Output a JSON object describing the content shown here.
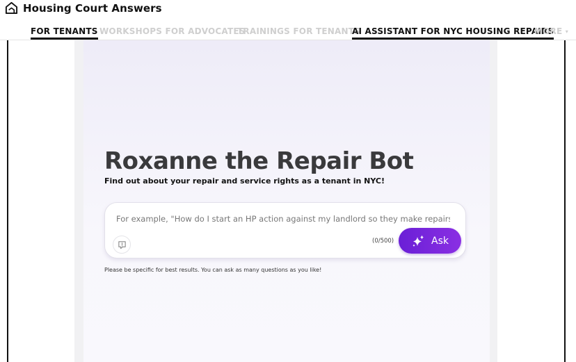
{
  "header": {
    "site_name": "Housing Court Answers",
    "logo_icon": "house-icon"
  },
  "nav": {
    "items": [
      {
        "label": "FOR TENANTS",
        "state": "active"
      },
      {
        "label": "WORKSHOPS FOR ADVOCATES",
        "state": "inactive"
      },
      {
        "label": "TRAININGS FOR TENANTS",
        "state": "inactive"
      },
      {
        "label": "AI ASSISTANT FOR NYC HOUSING REPAIRS",
        "state": "active"
      },
      {
        "label": "MORE",
        "state": "inactive",
        "icon": "chevron-down-icon"
      }
    ]
  },
  "main": {
    "title": "Roxanne the Repair Bot",
    "subtitle": "Find out about your repair and service rights as a tenant in NYC!",
    "query": {
      "value": "",
      "placeholder": "For example, \"How do I start an HP action against my landlord so they make repairs?\"",
      "char_count": "(0/500)",
      "ask_label": "Ask",
      "ask_icon": "sparkle-icon",
      "feedback_icon": "feedback-icon"
    },
    "hint": "Please be specific for best results. You can ask as many questions as you like!"
  },
  "colors": {
    "accent_start": "#6a1fd6",
    "accent_end": "#8a2fe3",
    "title": "#3a3a3c",
    "nav_inactive": "#cfcfcf",
    "nav_active": "#111111"
  }
}
